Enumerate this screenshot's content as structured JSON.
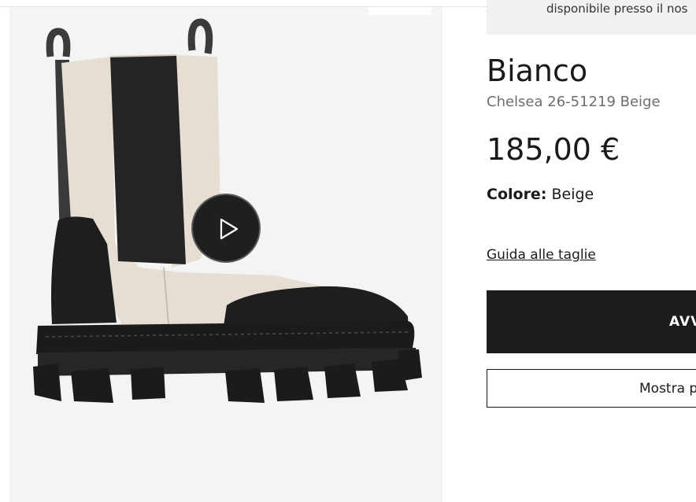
{
  "availability": {
    "text": "disponibile presso il nos"
  },
  "product": {
    "brand": "Bianco",
    "subtitle": "Chelsea 26-51219 Beige",
    "price": "185,00 €",
    "color_label": "Colore:",
    "color_value": "Beige",
    "size_guide": "Guida alle taglie"
  },
  "actions": {
    "primary_label": "AVV",
    "secondary_label": "Mostra p"
  },
  "gallery": {
    "image": "chelsea-boot-photo",
    "play_icon": "play-icon"
  },
  "colors": {
    "button_dark": "#1c1c1c",
    "gallery_bg": "#f4f4f4",
    "subtitle_gray": "#6e6e6e"
  }
}
